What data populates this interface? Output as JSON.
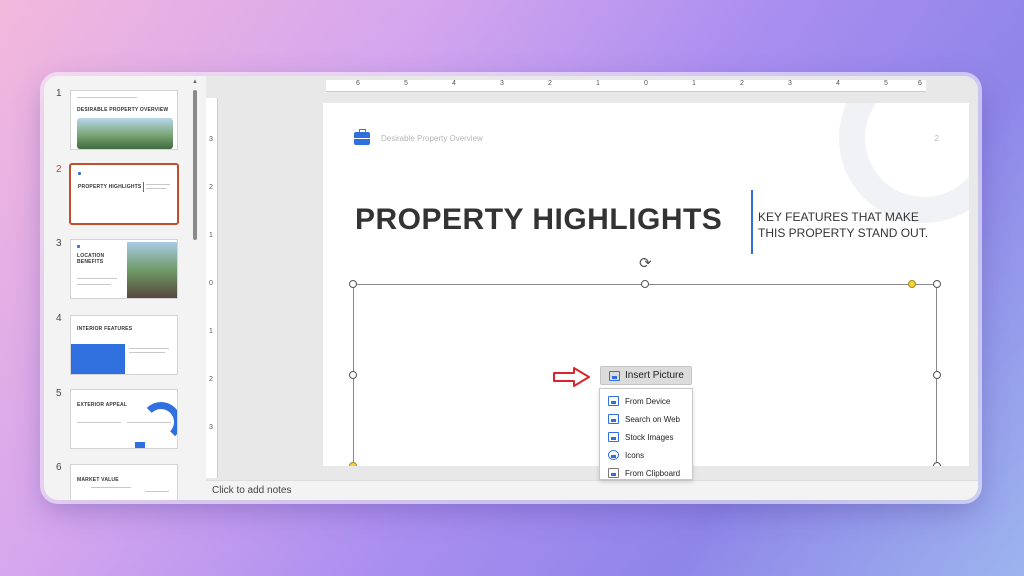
{
  "thumbnails": [
    {
      "number": "1",
      "title": "DESIRABLE PROPERTY OVERVIEW"
    },
    {
      "number": "2",
      "title": "PROPERTY HIGHLIGHTS"
    },
    {
      "number": "3",
      "title": "LOCATION BENEFITS"
    },
    {
      "number": "4",
      "title": "INTERIOR FEATURES"
    },
    {
      "number": "5",
      "title": "EXTERIOR APPEAL"
    },
    {
      "number": "6",
      "title": "MARKET VALUE"
    }
  ],
  "selected_slide": "2",
  "ruler": {
    "horizontal": [
      "6",
      "5",
      "4",
      "3",
      "2",
      "1",
      "0",
      "1",
      "2",
      "3",
      "4",
      "5",
      "6"
    ],
    "vertical": [
      "3",
      "2",
      "1",
      "0",
      "1",
      "2",
      "3"
    ]
  },
  "slide": {
    "header": "Desirable Property Overview",
    "page": "2",
    "title": "PROPERTY HIGHLIGHTS",
    "subtitle": "KEY FEATURES THAT MAKE THIS PROPERTY STAND OUT."
  },
  "insert_picture": {
    "label": "Insert Picture",
    "menu": [
      {
        "label": "From Device",
        "icon": "device-image-icon"
      },
      {
        "label": "Search on Web",
        "icon": "web-image-icon"
      },
      {
        "label": "Stock Images",
        "icon": "stock-images-icon"
      },
      {
        "label": "Icons",
        "icon": "icons-icon"
      },
      {
        "label": "From Clipboard",
        "icon": "clipboard-icon"
      }
    ]
  },
  "notes_placeholder": "Click to add notes",
  "colors": {
    "accent": "#2f6fde",
    "selection": "#c0502c",
    "arrow": "#d9262e",
    "handle_yellow": "#f6d43a"
  }
}
